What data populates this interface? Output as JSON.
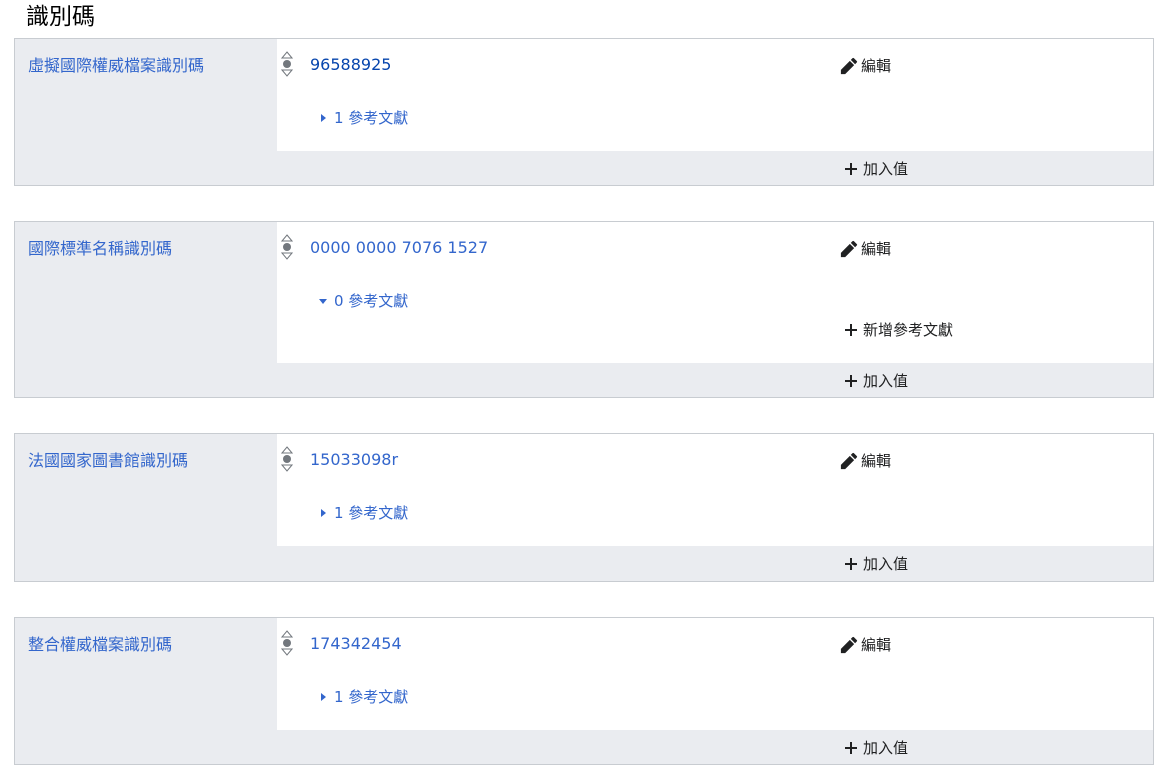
{
  "section": {
    "title": "識別碼"
  },
  "labels": {
    "edit": "編輯",
    "add_value": "加入值",
    "add_reference": "新增參考文獻"
  },
  "colors": {
    "link": "#3366cc",
    "visited_link": "#0645ad",
    "property_bg": "#eaecf0",
    "border": "#c8ccd1"
  },
  "statements": [
    {
      "property": "虛擬國際權威檔案識別碼",
      "value": "96588925",
      "references": "1 參考文獻",
      "references_expanded": false
    },
    {
      "property": "國際標準名稱識別碼",
      "value": "0000 0000 7076 1527",
      "references": "0 參考文獻",
      "references_expanded": true
    },
    {
      "property": "法國國家圖書館識別碼",
      "value": "15033098r",
      "references": "1 參考文獻",
      "references_expanded": false
    },
    {
      "property": "整合權威檔案識別碼",
      "value": "174342454",
      "references": "1 參考文獻",
      "references_expanded": false
    }
  ]
}
